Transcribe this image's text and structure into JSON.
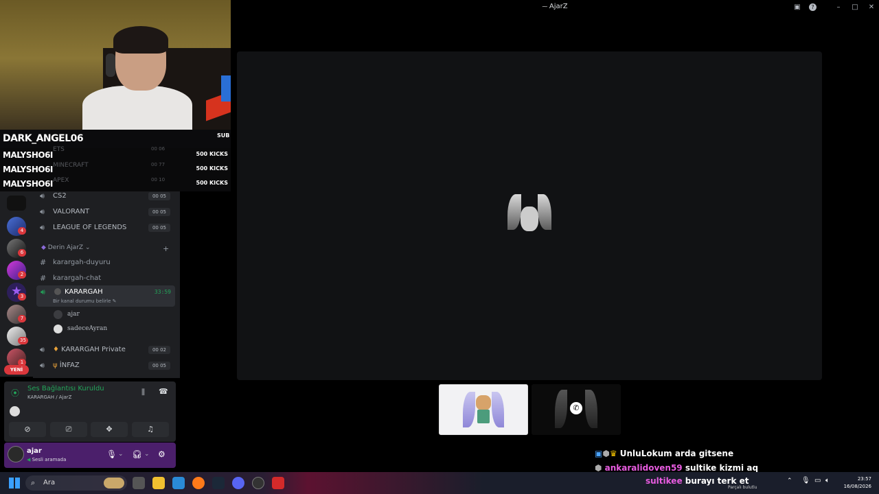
{
  "window": {
    "title": "AjarZ",
    "app_icon": "discord-icon"
  },
  "stream_overlay": {
    "username": "DARK_ANGEL06",
    "sub_label": "SUB",
    "kicks": [
      {
        "name": "MALYSHO6I",
        "amount": "500 KICKS"
      },
      {
        "name": "MALYSHO6I",
        "amount": "500 KICKS"
      },
      {
        "name": "MALYSHO6I",
        "amount": "500 KICKS"
      }
    ]
  },
  "guild_badges": [
    "4",
    "6",
    "2",
    "3",
    "7",
    "35",
    "1"
  ],
  "new_label": "YENİ",
  "channels": {
    "hidden": [
      {
        "name": "ETS",
        "count": "00 06"
      },
      {
        "name": "MINECRAFT",
        "count": "00 77"
      },
      {
        "name": "APEX",
        "count": "00 10"
      }
    ],
    "voice": [
      {
        "name": "CS2",
        "count": "00 05"
      },
      {
        "name": "VALORANT",
        "count": "00 05"
      },
      {
        "name": "LEAGUE OF LEGENDS",
        "count": "00 05"
      }
    ],
    "category": "Derin AjarZ",
    "text": [
      "karargah-duyuru",
      "karargah-chat"
    ],
    "active": {
      "name": "KARARGAH",
      "timer": "33:59",
      "status_hint": "Bir kanal durumu belirle"
    },
    "members": [
      "ajar",
      "sadeceAyran"
    ],
    "private": [
      {
        "name": "KARARGAH Private",
        "count": "00 02"
      },
      {
        "name": "İNFAZ",
        "count": "00 05"
      }
    ]
  },
  "voice_panel": {
    "status": "Ses Bağlantısı Kuruldu",
    "channel": "KARARGAH / AjarZ"
  },
  "user_panel": {
    "name": "ajar",
    "status": "Sesli aramada"
  },
  "chat": [
    {
      "user": "UnluLokum",
      "message": "arda gitsene"
    },
    {
      "user": "ankaralidoven59",
      "message": "sultike kizmi aq"
    },
    {
      "user": "sultikee",
      "message": "burayı terk et"
    }
  ],
  "taskbar": {
    "search_placeholder": "Ara",
    "time": "23:57",
    "date": "16/08/2026",
    "weather": "Parçalı bulutlu"
  },
  "colors": {
    "discord_green": "#23a55a",
    "discord_red": "#da373c",
    "user_panel": "#4b1f6b"
  }
}
